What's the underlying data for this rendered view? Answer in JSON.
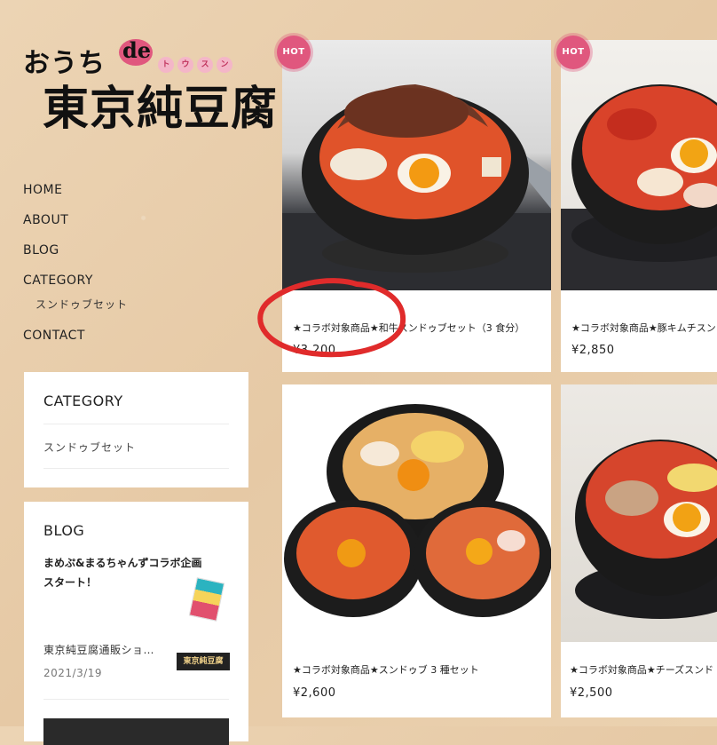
{
  "logo": {
    "line1": "おうち",
    "de": "de",
    "kana": [
      "ト",
      "ウ",
      "ス",
      "ン"
    ],
    "line2": "東京純豆腐"
  },
  "nav": {
    "items": [
      "HOME",
      "ABOUT",
      "BLOG",
      "CATEGORY",
      "CONTACT"
    ],
    "sub": "スンドゥブセット"
  },
  "category_widget": {
    "title": "CATEGORY",
    "link": "スンドゥブセット"
  },
  "blog_widget": {
    "title": "BLOG",
    "post1_line1": "まめぷ&まるちゃんずコラボ企画",
    "post1_line2": "スタート！",
    "post2_title": "東京純豆腐通販ショ…",
    "post2_date": "2021/3/19",
    "thumb2_text": "東京純豆腐"
  },
  "products": [
    {
      "badge": "HOT",
      "name": "★コラボ対象商品★和牛スンドゥブセット（3 食分）",
      "price": "¥3,200"
    },
    {
      "badge": "HOT",
      "name": "★コラボ対象商品★豚キムチスン",
      "price": "¥2,850"
    },
    {
      "name": "★コラボ対象商品★スンドゥブ 3 種セット",
      "price": "¥2,600"
    },
    {
      "name": "★コラボ対象商品★チーズスンド",
      "price": "¥2,500"
    }
  ],
  "colors": {
    "accent": "#e0577e",
    "annotation": "#e02b2b",
    "background": "#e9cfae"
  }
}
